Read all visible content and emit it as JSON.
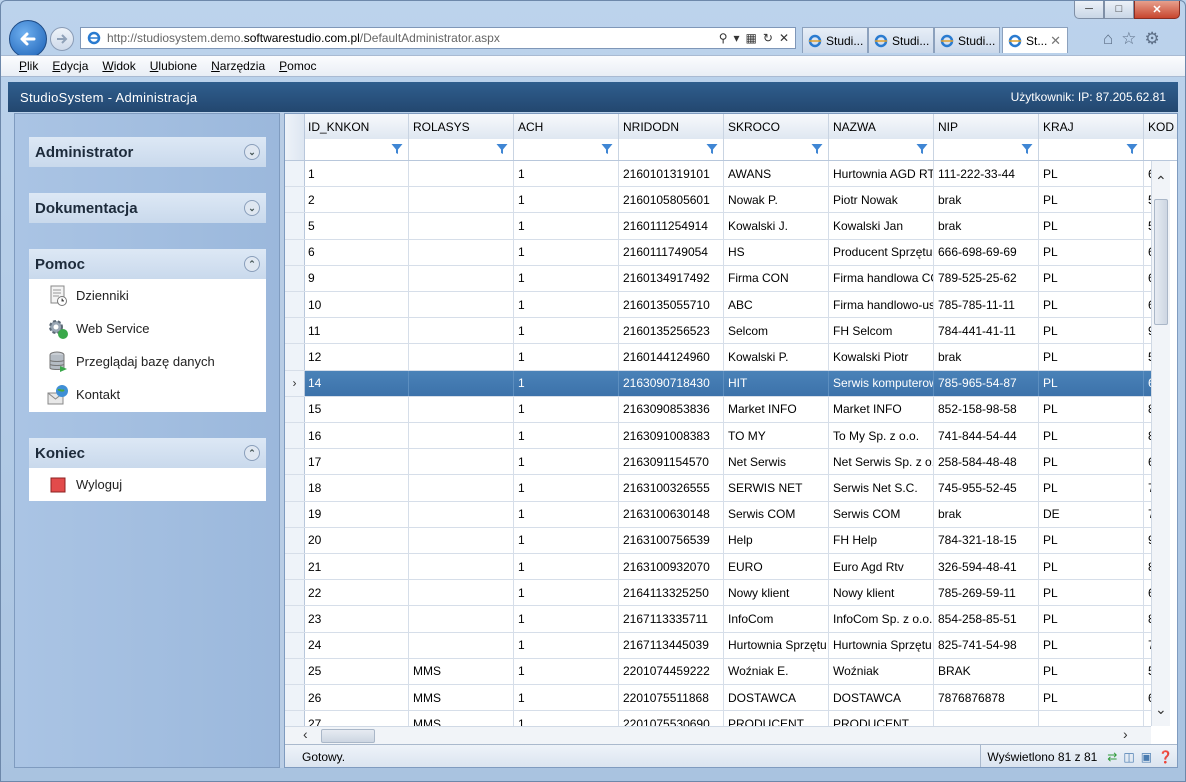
{
  "browser": {
    "url_prefix": "http://studiosystem.demo.",
    "url_domain": "softwarestudio.com.pl",
    "url_path": "/DefaultAdministrator.aspx",
    "tabs": [
      "Studi...",
      "Studi...",
      "Studi...",
      "St..."
    ],
    "menu": [
      "Plik",
      "Edycja",
      "Widok",
      "Ulubione",
      "Narzędzia",
      "Pomoc"
    ]
  },
  "app": {
    "title": "StudioSystem - Administracja",
    "user": "Użytkownik: IP: 87.205.62.81"
  },
  "sidebar": {
    "administrator": "Administrator",
    "dokumentacja": "Dokumentacja",
    "pomoc": "Pomoc",
    "pomoc_items": [
      "Dzienniki",
      "Web Service",
      "Przeglądaj bazę danych",
      "Kontakt"
    ],
    "koniec": "Koniec",
    "koniec_items": [
      "Wyloguj"
    ]
  },
  "grid": {
    "columns": [
      "ID_KNKON",
      "ROLASYS",
      "ACH",
      "NRIDODN",
      "SKROCO",
      "NAZWA",
      "NIP",
      "KRAJ",
      "KOD"
    ],
    "rows": [
      [
        "1",
        "",
        "1",
        "2160101319101",
        "AWANS",
        "Hurtownia AGD RTV",
        "111-222-33-44",
        "PL",
        "6"
      ],
      [
        "2",
        "",
        "1",
        "2160105805601",
        "Nowak P.",
        "Piotr Nowak",
        "brak",
        "PL",
        "5"
      ],
      [
        "5",
        "",
        "1",
        "2160111254914",
        "Kowalski J.",
        "Kowalski Jan",
        "brak",
        "PL",
        "5"
      ],
      [
        "6",
        "",
        "1",
        "2160111749054",
        "HS",
        "Producent Sprzętu",
        "666-698-69-69",
        "PL",
        "6"
      ],
      [
        "9",
        "",
        "1",
        "2160134917492",
        "Firma CON",
        "Firma handlowa CON",
        "789-525-25-62",
        "PL",
        "6"
      ],
      [
        "10",
        "",
        "1",
        "2160135055710",
        "ABC",
        "Firma handlowo-usł",
        "785-785-11-11",
        "PL",
        "6"
      ],
      [
        "11",
        "",
        "1",
        "2160135256523",
        "Selcom",
        "FH Selcom",
        "784-441-41-11",
        "PL",
        "9"
      ],
      [
        "12",
        "",
        "1",
        "2160144124960",
        "Kowalski P.",
        "Kowalski Piotr",
        "brak",
        "PL",
        "5"
      ],
      [
        "14",
        "",
        "1",
        "2163090718430",
        "HIT",
        "Serwis komputerowy",
        "785-965-54-87",
        "PL",
        "6"
      ],
      [
        "15",
        "",
        "1",
        "2163090853836",
        "Market INFO",
        "Market INFO",
        "852-158-98-58",
        "PL",
        "8"
      ],
      [
        "16",
        "",
        "1",
        "2163091008383",
        "TO MY",
        "To My Sp. z o.o.",
        "741-844-54-44",
        "PL",
        "8"
      ],
      [
        "17",
        "",
        "1",
        "2163091154570",
        "Net Serwis",
        "Net Serwis Sp. z o.o.",
        "258-584-48-48",
        "PL",
        "6"
      ],
      [
        "18",
        "",
        "1",
        "2163100326555",
        "SERWIS NET",
        "Serwis Net S.C.",
        "745-955-52-45",
        "PL",
        "7"
      ],
      [
        "19",
        "",
        "1",
        "2163100630148",
        "Serwis COM",
        "Serwis COM",
        "brak",
        "DE",
        "7"
      ],
      [
        "20",
        "",
        "1",
        "2163100756539",
        "Help",
        "FH Help",
        "784-321-18-15",
        "PL",
        "9"
      ],
      [
        "21",
        "",
        "1",
        "2163100932070",
        "EURO",
        "Euro Agd Rtv",
        "326-594-48-41",
        "PL",
        "8"
      ],
      [
        "22",
        "",
        "1",
        "2164113325250",
        "Nowy klient",
        "Nowy klient",
        "785-269-59-11",
        "PL",
        "6"
      ],
      [
        "23",
        "",
        "1",
        "2167113335711",
        "InfoCom",
        "InfoCom Sp. z o.o.",
        "854-258-85-51",
        "PL",
        "8"
      ],
      [
        "24",
        "",
        "1",
        "2167113445039",
        "Hurtownia Sprzętu",
        "Hurtownia Sprzętu",
        "825-741-54-98",
        "PL",
        "7"
      ],
      [
        "25",
        "MMS",
        "1",
        "2201074459222",
        "Woźniak E.",
        "Woźniak",
        "BRAK",
        "PL",
        "5"
      ],
      [
        "26",
        "MMS",
        "1",
        "2201075511868",
        "DOSTAWCA",
        "DOSTAWCA",
        "7876876878",
        "PL",
        "6"
      ],
      [
        "27",
        "MMS",
        "1",
        "2201075530690",
        "PRODUCENT",
        "PRODUCENT",
        "",
        "",
        ""
      ]
    ],
    "selected_row_index": 8
  },
  "status": {
    "ready": "Gotowy.",
    "count": "Wyświetlono 81 z 81"
  },
  "colors": {
    "header": "#2a5583",
    "selected_row": "#4379b0",
    "sidebar_bg": "#a4bfe1"
  }
}
